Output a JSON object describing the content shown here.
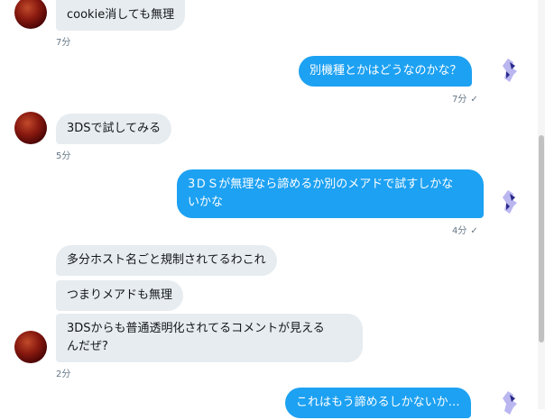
{
  "messages": [
    {
      "text": "cookie消しても無理"
    },
    {
      "text": "別機種とかはどうなのかな？"
    },
    {
      "text": "3DSで試してみる"
    },
    {
      "text_line1": "3ＤＳが無理なら諦めるか別のメアドで試すしかな",
      "text_line2": "いかな"
    },
    {
      "text": "多分ホスト名ごと規制されてるわこれ"
    },
    {
      "text": "つまりメアドも無理"
    },
    {
      "text_line1": "3DSからも普通透明化されてるコメントが見える",
      "text_line2": "んだぜ?"
    },
    {
      "text": "これはもう諦めるしかないか…"
    }
  ],
  "meta": {
    "t1": "7分",
    "t2": "7分",
    "t3": "5分",
    "t4": "4分",
    "t5": "2分"
  },
  "icons": {
    "read": "check-icon"
  },
  "colors": {
    "outgoing": "#1da1f2",
    "incoming": "#e6ecf0"
  }
}
